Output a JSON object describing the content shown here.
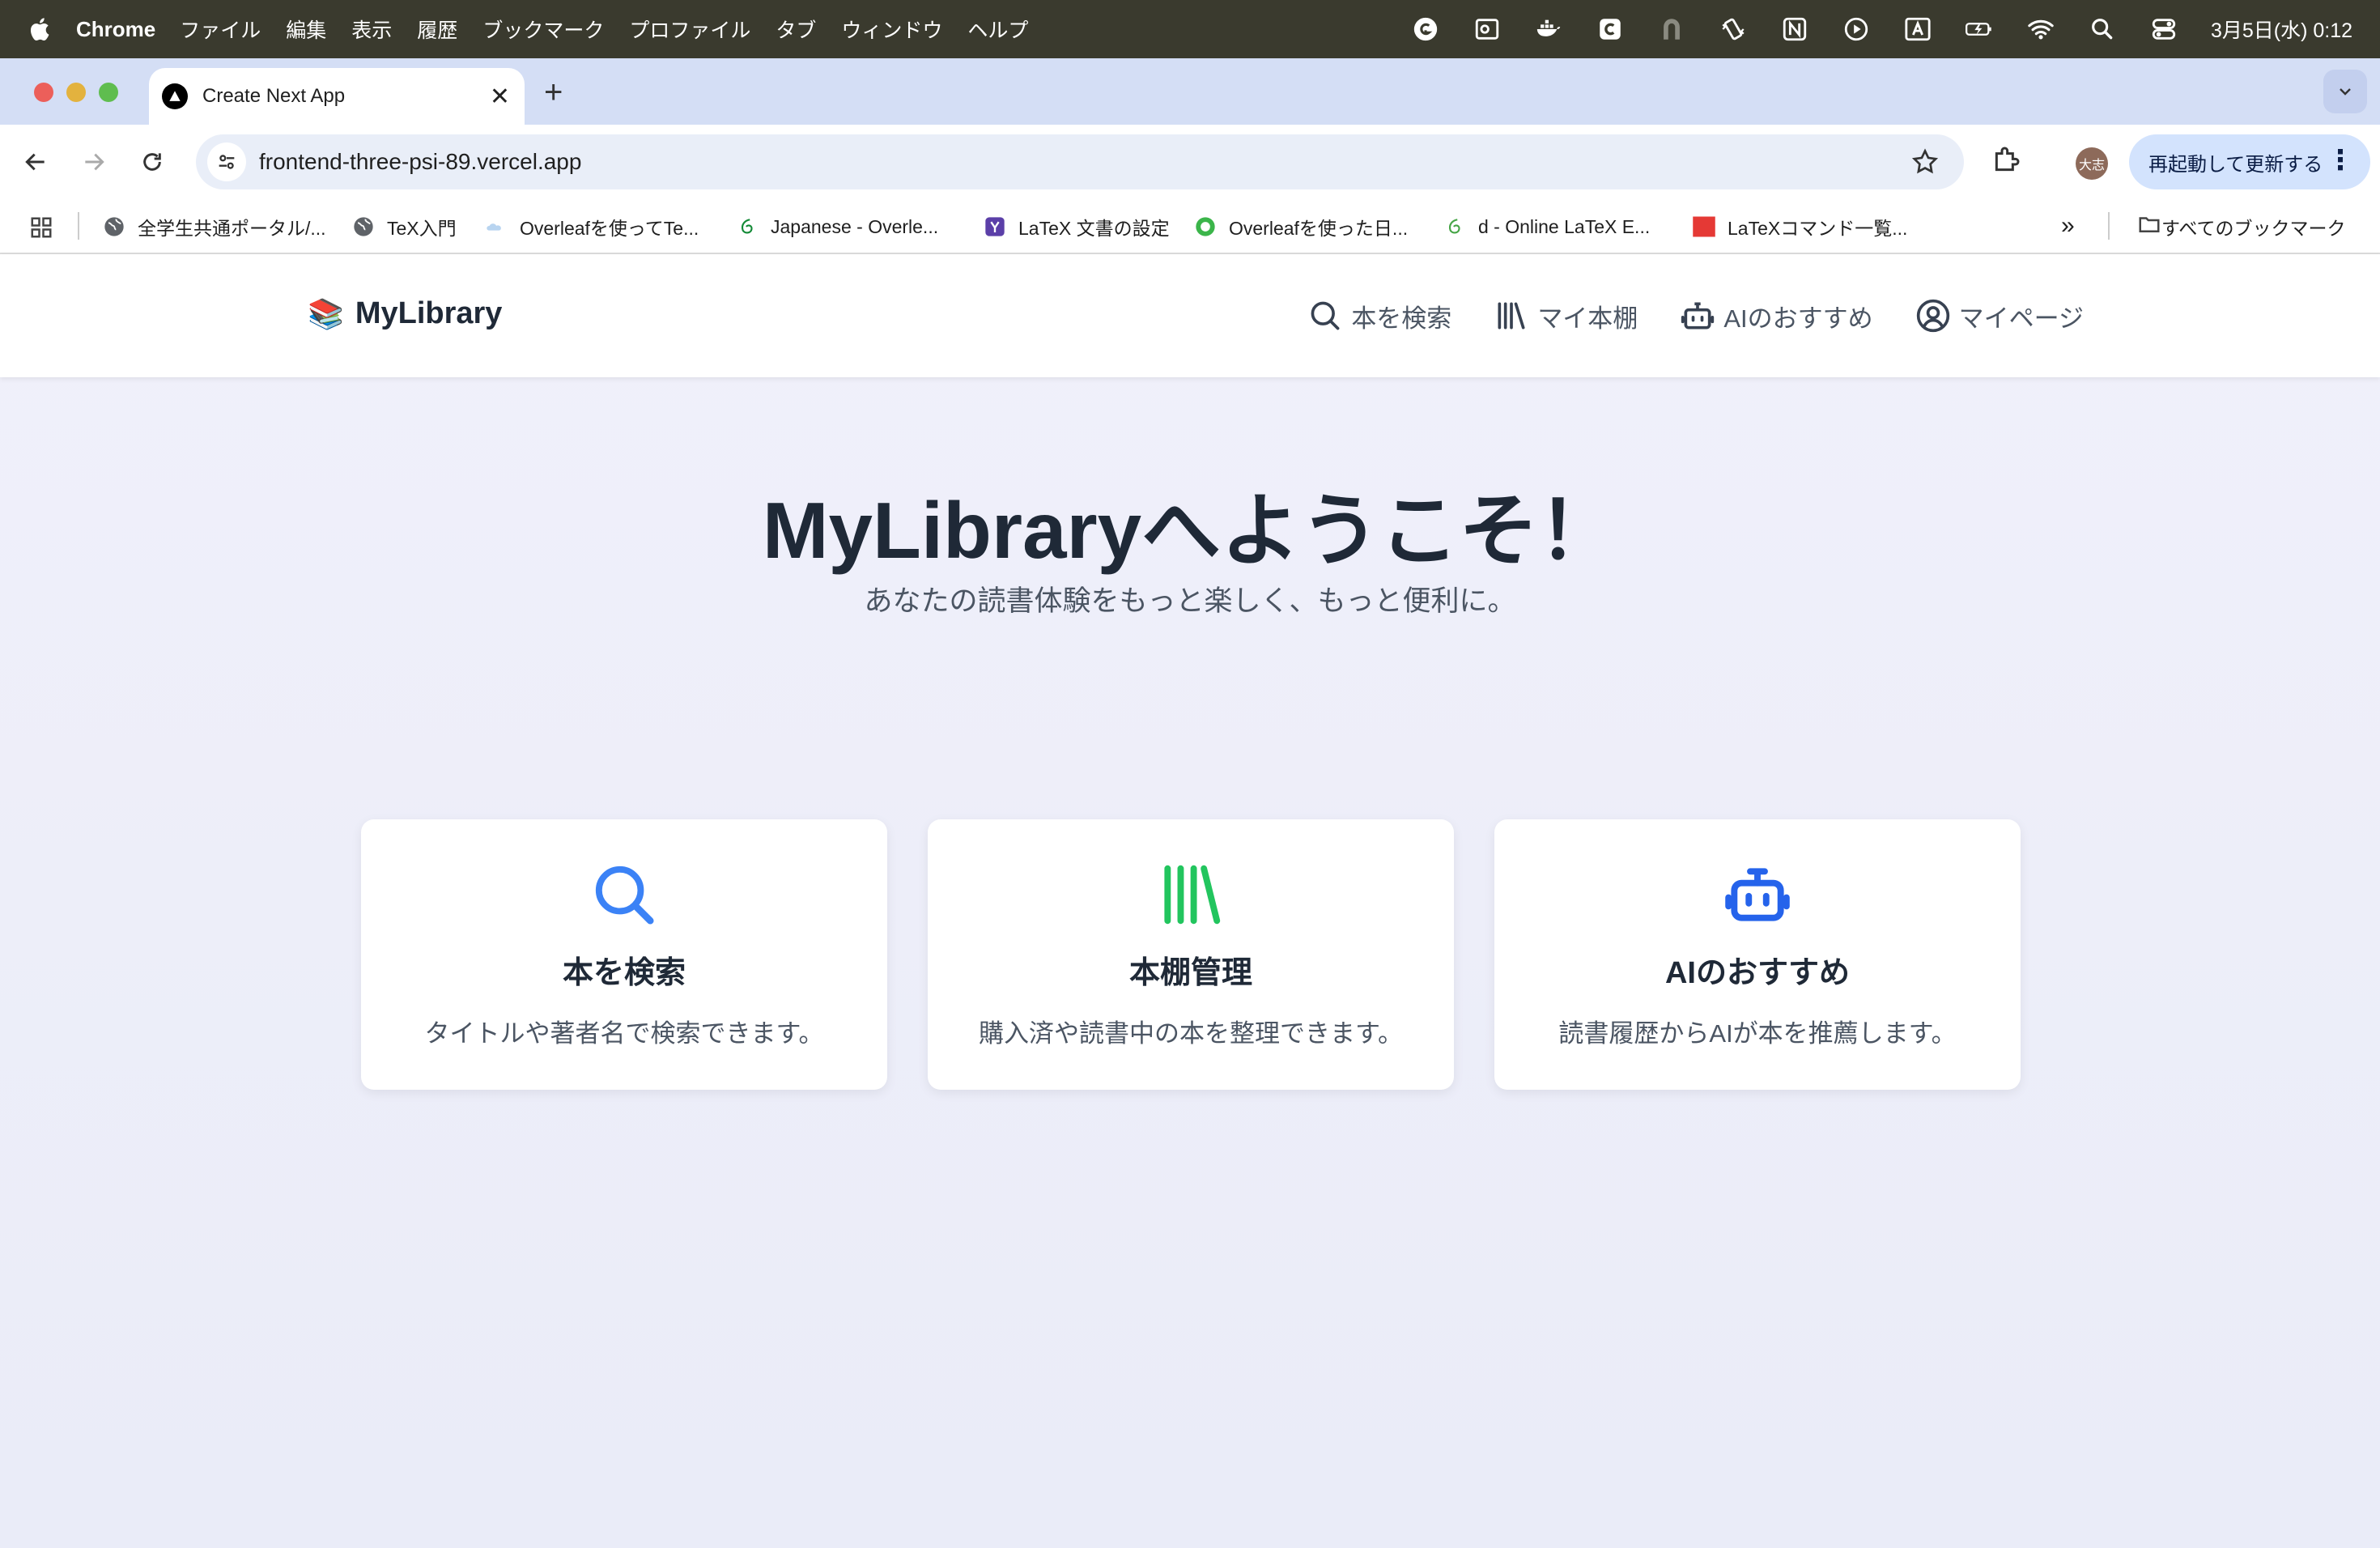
{
  "menubar": {
    "app_name": "Chrome",
    "items": [
      "ファイル",
      "編集",
      "表示",
      "履歴",
      "ブックマーク",
      "プロファイル",
      "タブ",
      "ウィンドウ",
      "ヘルプ"
    ],
    "clock": "3月5日(水) 0:12"
  },
  "browser": {
    "tab_title": "Create Next App",
    "url": "frontend-three-psi-89.vercel.app",
    "profile_label": "大志",
    "relaunch_label": "再起動して更新する",
    "bookmarks": [
      {
        "label": "全学生共通ポータル/...",
        "icon": "globe-icon"
      },
      {
        "label": "TeX入門",
        "icon": "globe-icon"
      },
      {
        "label": "Overleafを使ってTe...",
        "icon": "cloud-icon"
      },
      {
        "label": "Japanese - Overle...",
        "icon": "overleaf-icon"
      },
      {
        "label": "LaTeX 文書の設定",
        "icon": "y-icon"
      },
      {
        "label": "Overleafを使った日...",
        "icon": "green-circle-icon"
      },
      {
        "label": "d - Online LaTeX E...",
        "icon": "overleaf-icon"
      },
      {
        "label": "LaTeXコマンド一覧...",
        "icon": "red-square-icon"
      }
    ],
    "all_bookmarks": "すべてのブックマーク"
  },
  "site": {
    "logo_icon": "📚",
    "logo_text": "MyLibrary",
    "nav": {
      "search": "本を検索",
      "shelf": "マイ本棚",
      "ai": "AIのおすすめ",
      "mypage": "マイページ"
    },
    "hero_title": "MyLibraryへようこそ！",
    "hero_subtitle": "あなたの読書体験をもっと楽しく、もっと便利に。",
    "cards": [
      {
        "title": "本を検索",
        "description": "タイトルや著者名で検索できます。",
        "icon": "search-icon",
        "color": "#3b82f6"
      },
      {
        "title": "本棚管理",
        "description": "購入済や読書中の本を整理できます。",
        "icon": "bookshelf-icon",
        "color": "#22c55e"
      },
      {
        "title": "AIのおすすめ",
        "description": "読書履歴からAIが本を推薦します。",
        "icon": "robot-icon",
        "color": "#2563eb"
      }
    ]
  }
}
